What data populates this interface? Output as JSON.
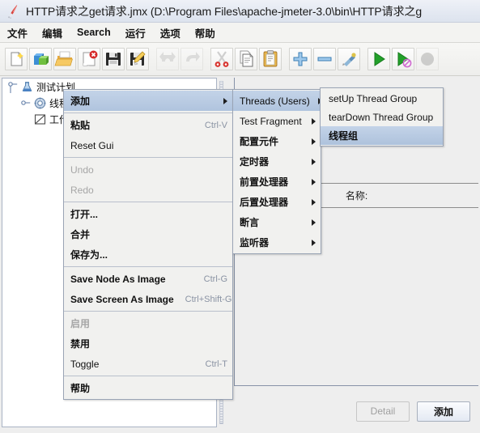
{
  "window": {
    "title": "HTTP请求之get请求.jmx (D:\\Program Files\\apache-jmeter-3.0\\bin\\HTTP请求之g",
    "app_icon": "jmeter-feather-icon"
  },
  "menubar": {
    "items": [
      {
        "label": "文件",
        "name": "menu-file"
      },
      {
        "label": "编辑",
        "name": "menu-edit"
      },
      {
        "label": "Search",
        "name": "menu-search"
      },
      {
        "label": "运行",
        "name": "menu-run"
      },
      {
        "label": "选项",
        "name": "menu-options"
      },
      {
        "label": "帮助",
        "name": "menu-help"
      }
    ]
  },
  "toolbar": {
    "buttons": [
      {
        "icon": "new-document-icon",
        "name": "toolbar-new",
        "disabled": false
      },
      {
        "icon": "templates-icon",
        "name": "toolbar-templates",
        "disabled": false
      },
      {
        "icon": "open-folder-icon",
        "name": "toolbar-open",
        "disabled": false
      },
      {
        "icon": "close-document-icon",
        "name": "toolbar-close",
        "disabled": false
      },
      {
        "icon": "save-floppy-icon",
        "name": "toolbar-save",
        "disabled": false
      },
      {
        "icon": "save-as-icon",
        "name": "toolbar-save-as",
        "disabled": false
      },
      {
        "icon": "undo-arrow-icon",
        "name": "toolbar-undo",
        "disabled": true
      },
      {
        "icon": "redo-arrow-icon",
        "name": "toolbar-redo",
        "disabled": true
      },
      {
        "icon": "scissors-cut-icon",
        "name": "toolbar-cut",
        "disabled": false
      },
      {
        "icon": "copy-pages-icon",
        "name": "toolbar-copy",
        "disabled": false
      },
      {
        "icon": "clipboard-paste-icon",
        "name": "toolbar-paste",
        "disabled": false
      },
      {
        "icon": "plus-expand-icon",
        "name": "toolbar-expand-all",
        "disabled": false
      },
      {
        "icon": "minus-collapse-icon",
        "name": "toolbar-collapse-all",
        "disabled": false
      },
      {
        "icon": "toggle-element-icon",
        "name": "toolbar-toggle",
        "disabled": false
      },
      {
        "icon": "play-start-icon",
        "name": "toolbar-start",
        "disabled": false
      },
      {
        "icon": "play-no-pauses-icon",
        "name": "toolbar-start-no-pauses",
        "disabled": false
      },
      {
        "icon": "stop-icon",
        "name": "toolbar-stop",
        "disabled": true
      }
    ]
  },
  "tree": {
    "nodes": [
      {
        "label": "测试计划",
        "icon": "test-plan-icon",
        "name": "tree-node-test-plan",
        "depth": 0
      },
      {
        "label": "线程组",
        "icon": "thread-group-icon",
        "name": "tree-node-thread-group",
        "depth": 1
      },
      {
        "label": "工作台",
        "icon": "workbench-icon",
        "name": "tree-node-workbench",
        "depth": 0
      }
    ]
  },
  "right_panel": {
    "name_label": "名称:",
    "buttons": {
      "detail": "Detail",
      "add": "添加"
    }
  },
  "context_menu": {
    "items": [
      {
        "label": "添加",
        "accel": "",
        "name": "ctx-add",
        "selected": true,
        "submenu": true,
        "disabled": false,
        "bold": true
      },
      {
        "type": "separator"
      },
      {
        "label": "粘贴",
        "accel": "Ctrl-V",
        "name": "ctx-paste",
        "selected": false,
        "submenu": false,
        "disabled": false,
        "bold": true
      },
      {
        "label": "Reset Gui",
        "accel": "",
        "name": "ctx-reset-gui",
        "selected": false,
        "submenu": false,
        "disabled": false,
        "bold": false
      },
      {
        "type": "separator"
      },
      {
        "label": "Undo",
        "accel": "",
        "name": "ctx-undo",
        "selected": false,
        "submenu": false,
        "disabled": true,
        "bold": false
      },
      {
        "label": "Redo",
        "accel": "",
        "name": "ctx-redo",
        "selected": false,
        "submenu": false,
        "disabled": true,
        "bold": false
      },
      {
        "type": "separator"
      },
      {
        "label": "打开...",
        "accel": "",
        "name": "ctx-open",
        "selected": false,
        "submenu": false,
        "disabled": false,
        "bold": true
      },
      {
        "label": "合并",
        "accel": "",
        "name": "ctx-merge",
        "selected": false,
        "submenu": false,
        "disabled": false,
        "bold": true
      },
      {
        "label": "保存为...",
        "accel": "",
        "name": "ctx-save-as",
        "selected": false,
        "submenu": false,
        "disabled": false,
        "bold": true
      },
      {
        "type": "separator"
      },
      {
        "label": "Save Node As Image",
        "accel": "Ctrl-G",
        "name": "ctx-save-node-as-image",
        "selected": false,
        "submenu": false,
        "disabled": false,
        "bold": true
      },
      {
        "label": "Save Screen As Image",
        "accel": "Ctrl+Shift-G",
        "name": "ctx-save-screen-as-image",
        "selected": false,
        "submenu": false,
        "disabled": false,
        "bold": true
      },
      {
        "type": "separator"
      },
      {
        "label": "启用",
        "accel": "",
        "name": "ctx-enable",
        "selected": false,
        "submenu": false,
        "disabled": true,
        "bold": true
      },
      {
        "label": "禁用",
        "accel": "",
        "name": "ctx-disable",
        "selected": false,
        "submenu": false,
        "disabled": false,
        "bold": true
      },
      {
        "label": "Toggle",
        "accel": "Ctrl-T",
        "name": "ctx-toggle",
        "selected": false,
        "submenu": false,
        "disabled": false,
        "bold": false
      },
      {
        "type": "separator"
      },
      {
        "label": "帮助",
        "accel": "",
        "name": "ctx-help",
        "selected": false,
        "submenu": false,
        "disabled": false,
        "bold": true
      }
    ]
  },
  "add_submenu": {
    "items": [
      {
        "label": "Threads (Users)",
        "name": "submenu-threads-users",
        "selected": true,
        "bold": false
      },
      {
        "label": "Test Fragment",
        "name": "submenu-test-fragment",
        "selected": false,
        "bold": false
      },
      {
        "label": "配置元件",
        "name": "submenu-config-element",
        "selected": false,
        "bold": true
      },
      {
        "label": "定时器",
        "name": "submenu-timer",
        "selected": false,
        "bold": true
      },
      {
        "label": "前置处理器",
        "name": "submenu-pre-processor",
        "selected": false,
        "bold": true
      },
      {
        "label": "后置处理器",
        "name": "submenu-post-processor",
        "selected": false,
        "bold": true
      },
      {
        "label": "断言",
        "name": "submenu-assertion",
        "selected": false,
        "bold": true
      },
      {
        "label": "监听器",
        "name": "submenu-listener",
        "selected": false,
        "bold": true
      }
    ]
  },
  "threads_submenu": {
    "items": [
      {
        "label": "setUp Thread Group",
        "name": "submenu-setup-thread-group",
        "selected": false,
        "bold": false
      },
      {
        "label": "tearDown Thread Group",
        "name": "submenu-teardown-thread-group",
        "selected": false,
        "bold": false
      },
      {
        "label": "线程组",
        "name": "submenu-thread-group",
        "selected": true,
        "bold": true
      }
    ]
  }
}
